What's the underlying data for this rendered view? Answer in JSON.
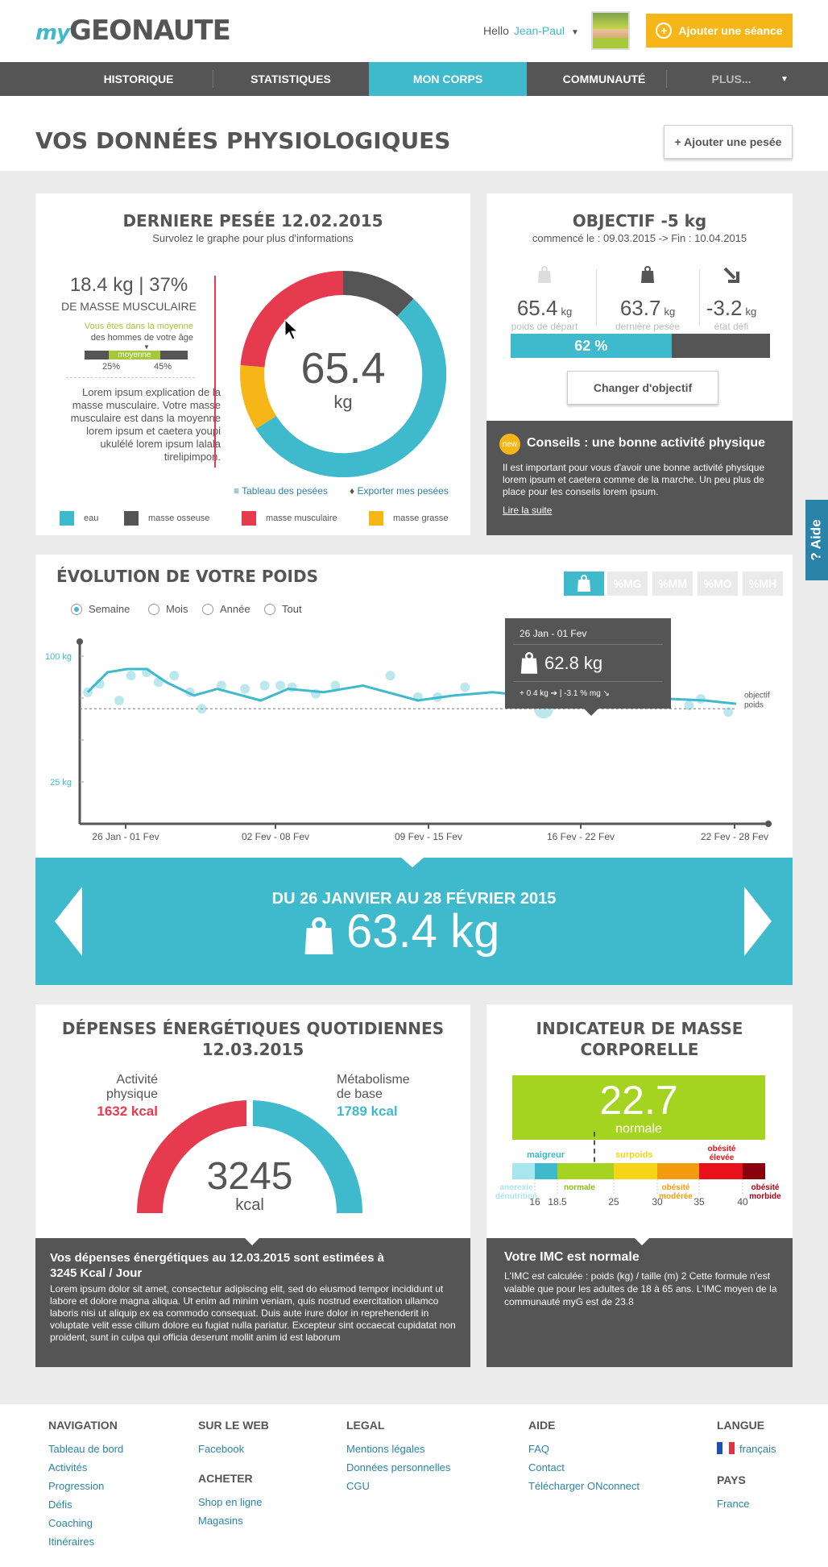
{
  "header": {
    "logo_my": "my",
    "logo_main": "GEONAUTE",
    "hello": "Hello",
    "user_name": "Jean-Paul",
    "add_session": "Ajouter une séance"
  },
  "nav": {
    "items": [
      "HISTORIQUE",
      "STATISTIQUES",
      "MON CORPS",
      "COMMUNAUTÉ",
      "PLUS..."
    ]
  },
  "page": {
    "title": "VOS DONNÉES PHYSIOLOGIQUES",
    "add_weighing": "+ Ajouter une pesée"
  },
  "last_weighing": {
    "title": "DERNIERE PESÉE 12.02.2015",
    "subtitle": "Survolez le graphe pour plus d'informations",
    "stat": "18.4 kg | 37%",
    "stat_label": "DE MASSE MUSCULAIRE",
    "average_note": "Vous êtes dans la moyenne",
    "average_note2": "des hommes de votre âge",
    "scale_label": "moyenne",
    "scale_low": "25%",
    "scale_high": "45%",
    "explanation": "Lorem ipsum explication de la masse musculaire. Votre masse musculaire est dans la moyenne lorem ipsum et caetera youpi ukulélé lorem ipsum lalala tirelipimpon.",
    "donut_value": "65.4",
    "donut_unit": "kg",
    "link_table": "Tableau des pesées",
    "link_export": "Exporter mes pesées",
    "legend": [
      {
        "label": "eau",
        "color": "#3fb9cc"
      },
      {
        "label": "masse osseuse",
        "color": "#555555"
      },
      {
        "label": "masse musculaire",
        "color": "#e63a4f"
      },
      {
        "label": "masse grasse",
        "color": "#f7b618"
      }
    ]
  },
  "objective": {
    "title": "OBJECTIF -5 kg",
    "dates": "commencé le : 09.03.2015 -> Fin : 10.04.2015",
    "cols": [
      {
        "value": "65.4",
        "unit": "kg",
        "label": "poids de départ"
      },
      {
        "value": "63.7",
        "unit": "kg",
        "label": "dernière pesée"
      },
      {
        "value": "-3.2",
        "unit": "kg",
        "label": "état défi"
      }
    ],
    "progress": 0.62,
    "progress_label": "62 %",
    "change_button": "Changer d'objectif",
    "advice_badge": "new",
    "advice_title": "Conseils : une bonne activité physique",
    "advice_text": "Il est important pour vous d'avoir une bonne activité physique lorem ipsum et caetera comme de la marche. Un peu plus de place pour les conseils lorem ipsum.",
    "advice_link": "Lire la suite"
  },
  "help": {
    "label": "? Aide"
  },
  "evolution": {
    "title": "ÉVOLUTION DE VOTRE POIDS",
    "tabs": [
      "%MG",
      "%MM",
      "%MO",
      "%MH"
    ],
    "periods": [
      "Semaine",
      "Mois",
      "Année",
      "Tout"
    ],
    "selected_period": "Semaine",
    "tooltip_date": "26 Jan - 01 Fev",
    "tooltip_value": "62.8 kg",
    "tooltip_detail1": "+ 0.4 kg",
    "tooltip_detail2": "| -3.1 % mg",
    "objective_label1": "objectif",
    "objective_label2": "poids",
    "summary_title": "DU 26  JANVIER AU 28 FÉVRIER 2015",
    "summary_value": "63.4 kg"
  },
  "chart_data": {
    "type": "line",
    "x": [
      "26 Jan - 01 Fev",
      "02 Fev - 08 Fev",
      "09 Fev - 15 Fev",
      "16 Fev - 22 Fev",
      "22 Fev - 28 Fev"
    ],
    "y_ticks": [
      "100 kg",
      "25 kg"
    ],
    "line": [
      [
        0,
        60
      ],
      [
        0.5,
        72
      ],
      [
        1,
        74
      ],
      [
        1.5,
        74
      ],
      [
        2,
        66
      ],
      [
        2.7,
        58
      ],
      [
        3.3,
        62
      ],
      [
        4.4,
        55
      ],
      [
        5.1,
        62
      ],
      [
        6,
        60
      ],
      [
        7,
        64
      ],
      [
        8.4,
        55
      ],
      [
        9.3,
        58
      ],
      [
        10.3,
        60
      ],
      [
        11.6,
        57
      ],
      [
        12.7,
        57
      ],
      [
        13.8,
        58
      ],
      [
        14.8,
        56
      ],
      [
        15.7,
        55
      ],
      [
        16.5,
        53
      ]
    ],
    "points": [
      [
        0,
        60
      ],
      [
        0.3,
        65
      ],
      [
        0.8,
        55
      ],
      [
        1.1,
        70
      ],
      [
        1.5,
        72
      ],
      [
        1.8,
        66
      ],
      [
        2.2,
        70
      ],
      [
        2.6,
        60
      ],
      [
        2.9,
        50
      ],
      [
        3.4,
        64
      ],
      [
        4.0,
        62
      ],
      [
        4.5,
        64
      ],
      [
        4.9,
        64
      ],
      [
        5.2,
        63
      ],
      [
        5.8,
        59
      ],
      [
        6.3,
        64
      ],
      [
        7.7,
        70
      ],
      [
        8.4,
        57
      ],
      [
        8.9,
        57
      ],
      [
        9.6,
        63
      ],
      [
        11.2,
        60
      ],
      [
        11.6,
        50
      ],
      [
        11.9,
        61
      ],
      [
        12.6,
        60
      ],
      [
        13.4,
        58
      ],
      [
        14.2,
        57
      ],
      [
        15.3,
        52
      ],
      [
        15.6,
        56
      ],
      [
        16.3,
        48
      ]
    ],
    "objective": 50,
    "ylabel": "",
    "xlabel": ""
  },
  "energy": {
    "title": "DÉPENSES ÉNERGÉTIQUES QUOTIDIENNES",
    "date": "12.03.2015",
    "left_label1": "Activité",
    "left_label2": "physique",
    "left_value": "1632 kcal",
    "right_label1": "Métabolisme",
    "right_label2": "de base",
    "right_value": "1789 kcal",
    "total": "3245",
    "unit": "kcal",
    "box_title": "Vos dépenses énergétiques au 12.03.2015 sont estimées à 3245 Kcal / Jour",
    "box_text": "Lorem ipsum dolor sit amet, consectetur adipiscing elit, sed do eiusmod tempor incididunt ut labore et dolore magna aliqua. Ut enim ad minim veniam, quis nostrud exercitation ullamco laboris nisi ut aliquip ex ea commodo consequat. Duis aute irure dolor in reprehenderit in voluptate velit esse cillum dolore eu fugiat nulla pariatur. Excepteur sint occaecat cupidatat non proident, sunt in culpa qui officia deserunt mollit anim id est laborum"
  },
  "bmi": {
    "title1": "INDICATEUR DE MASSE",
    "title2": "CORPORELLE",
    "value": "22.7",
    "status": "normale",
    "labels_top": [
      "maigreur",
      "surpoids",
      "obésité élevée"
    ],
    "labels_bottom": [
      "anorexie dénutrition",
      "normale",
      "obésité modérée",
      "obésité morbide"
    ],
    "ticks": [
      "16",
      "18.5",
      "25",
      "30",
      "35",
      "40"
    ],
    "box_title": "Votre IMC est normale",
    "box_text": "L'IMC est calculée : poids (kg) / taille (m) 2 Cette formule n'est valable que pour les adultes de 18 à 65 ans. L'IMC moyen de la communauté myG est de 23.8"
  },
  "footer": {
    "navigation_title": "NAVIGATION",
    "navigation": [
      "Tableau de bord",
      "Activités",
      "Progression",
      "Défis",
      "Coaching",
      "Itinéraires"
    ],
    "web_title": "SUR LE WEB",
    "web": [
      "Facebook"
    ],
    "buy_title": "ACHETER",
    "buy": [
      "Shop en ligne",
      "Magasins"
    ],
    "legal_title": "LEGAL",
    "legal": [
      "Mentions légales",
      "Données personnelles",
      "CGU"
    ],
    "help_title": "AIDE",
    "help": [
      "FAQ",
      "Contact",
      "Télécharger ONconnect"
    ],
    "lang_title": "LANGUE",
    "lang": "français",
    "country_title": "PAYS",
    "country": "France"
  }
}
